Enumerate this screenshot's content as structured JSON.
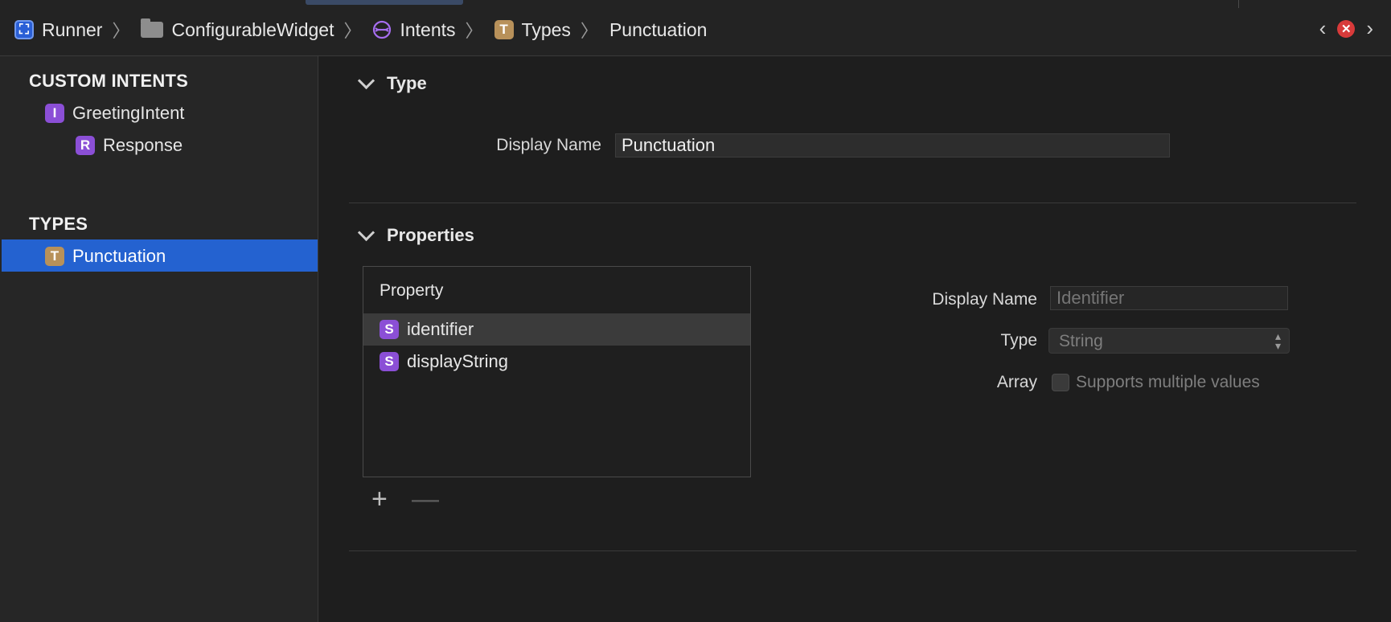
{
  "breadcrumb": {
    "items": [
      {
        "label": "Runner",
        "icon": "app-icon"
      },
      {
        "label": "ConfigurableWidget",
        "icon": "folder-icon"
      },
      {
        "label": "Intents",
        "icon": "intents-icon"
      },
      {
        "label": "Types",
        "icon": "type-icon"
      },
      {
        "label": "Punctuation",
        "icon": ""
      }
    ],
    "separator": "〉"
  },
  "nav": {
    "back": "‹",
    "forward": "›",
    "close": "✕"
  },
  "sidebar": {
    "custom_intents_header": "CUSTOM INTENTS",
    "intent": {
      "badge": "I",
      "label": "GreetingIntent"
    },
    "response": {
      "badge": "R",
      "label": "Response"
    },
    "types_header": "TYPES",
    "type_item": {
      "badge": "T",
      "label": "Punctuation"
    }
  },
  "type_section": {
    "title": "Type",
    "display_name_label": "Display Name",
    "display_name_value": "Punctuation"
  },
  "properties_section": {
    "title": "Properties",
    "table_header": "Property",
    "rows": [
      {
        "badge": "S",
        "label": "identifier",
        "selected": true
      },
      {
        "badge": "S",
        "label": "displayString",
        "selected": false
      }
    ],
    "add_label": "+",
    "remove_label": "—"
  },
  "property_detail": {
    "display_name_label": "Display Name",
    "display_name_placeholder": "Identifier",
    "type_label": "Type",
    "type_value": "String",
    "array_label": "Array",
    "array_checkbox_label": "Supports multiple values",
    "array_checked": false
  },
  "colors": {
    "selection": "#2462d0",
    "type_badge": "#b8915a",
    "intent_badge": "#8b4fd6",
    "close": "#d83a3a"
  }
}
